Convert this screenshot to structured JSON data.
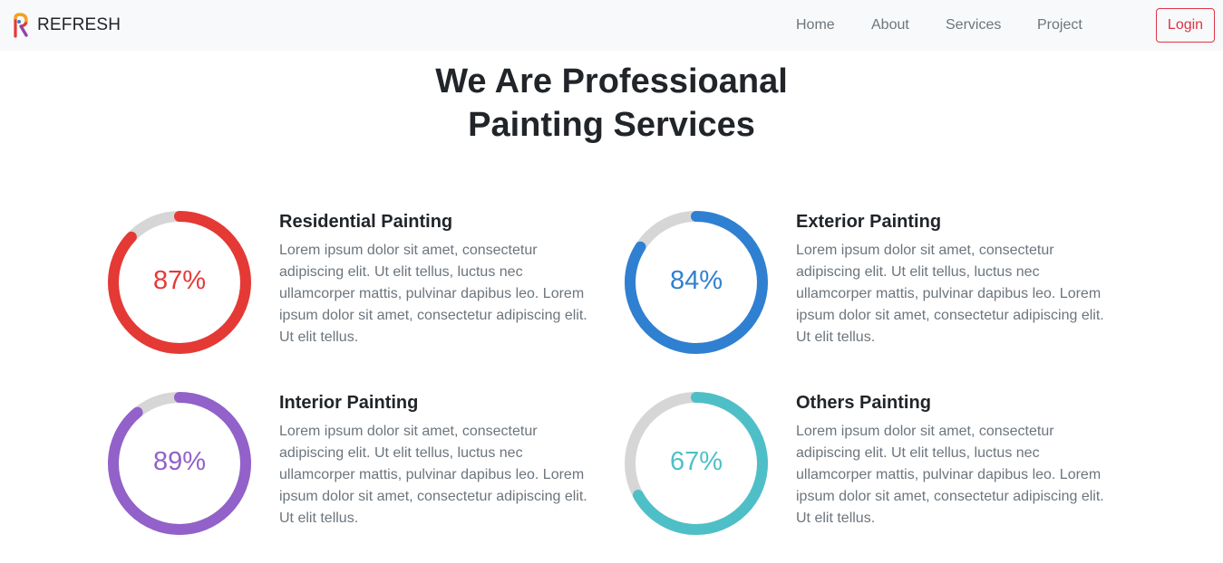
{
  "navbar": {
    "brand": "REFRESH",
    "links": [
      "Home",
      "About",
      "Services",
      "Project"
    ],
    "login_label": "Login"
  },
  "hero": {
    "title_line1": "We Are Professioanal",
    "title_line2": "Painting Services"
  },
  "services": [
    {
      "title": "Residential Painting",
      "percent": 87,
      "percent_label": "87%",
      "color": "#e53935",
      "description": "Lorem ipsum dolor sit amet, consectetur adipiscing elit. Ut elit tellus, luctus nec ullamcorper mattis, pulvinar dapibus leo. Lorem ipsum dolor sit amet, consectetur adipiscing elit. Ut elit tellus."
    },
    {
      "title": "Exterior Painting",
      "percent": 84,
      "percent_label": "84%",
      "color": "#2f80d1",
      "description": "Lorem ipsum dolor sit amet, consectetur adipiscing elit. Ut elit tellus, luctus nec ullamcorper mattis, pulvinar dapibus leo. Lorem ipsum dolor sit amet, consectetur adipiscing elit. Ut elit tellus."
    },
    {
      "title": "Interior Painting",
      "percent": 89,
      "percent_label": "89%",
      "color": "#9261c9",
      "description": "Lorem ipsum dolor sit amet, consectetur adipiscing elit. Ut elit tellus, luctus nec ullamcorper mattis, pulvinar dapibus leo. Lorem ipsum dolor sit amet, consectetur adipiscing elit. Ut elit tellus."
    },
    {
      "title": "Others Painting",
      "percent": 67,
      "percent_label": "67%",
      "color": "#4fbfc7",
      "description": "Lorem ipsum dolor sit amet, consectetur adipiscing elit. Ut elit tellus, luctus nec ullamcorper mattis, pulvinar dapibus leo. Lorem ipsum dolor sit amet, consectetur adipiscing elit. Ut elit tellus."
    }
  ],
  "ring_track_color": "#d6d6d6"
}
